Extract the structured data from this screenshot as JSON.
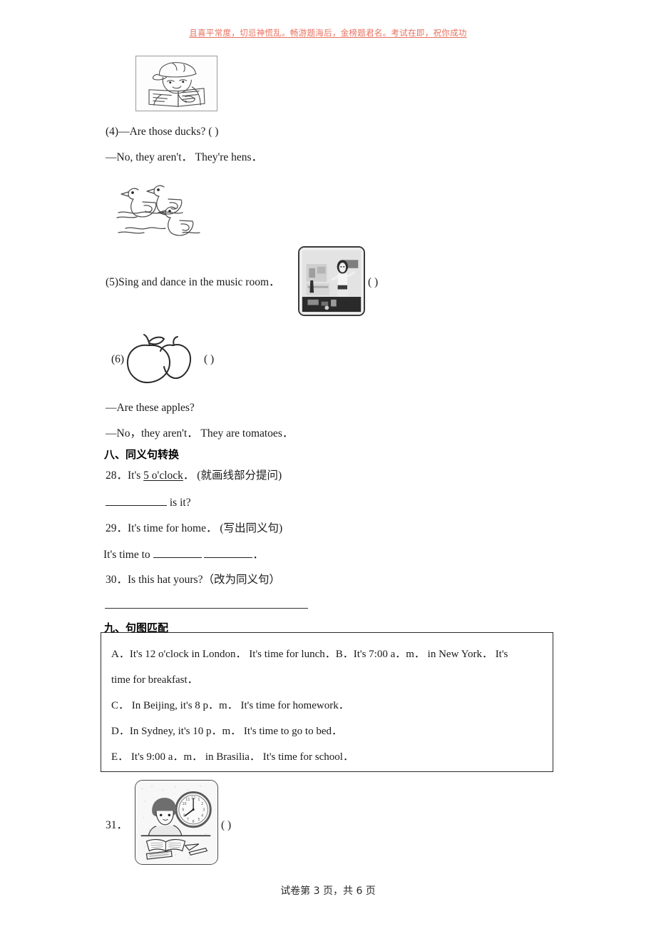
{
  "header": {
    "slogan": "且喜平常度，切忌神慌乱。畅游题海后，金榜题君名。考试在即，祝你成功"
  },
  "questions": {
    "q4_line1": "(4)—Are those ducks?    (      )",
    "q4_line2": "—No, they aren't．  They're hens．",
    "q5_line": "(5)Sing and dance in the music room．",
    "q5_bracket": "(      )",
    "q6_number": "(6)",
    "q6_bracket": "(      )",
    "q6_line1": "—Are these apples?",
    "q6_line2": "—No，they aren't．  They are tomatoes．"
  },
  "section8": {
    "heading": "八、同义句转换",
    "q28_prefix": "28．It's ",
    "q28_underlined": "5 o'clock",
    "q28_suffix": "．  (就画线部分提问)",
    "q28_answer_suffix": " is it?",
    "q29": "29．It's time for home．  (写出同义句)",
    "q29_answer_prefix": "It's time to ",
    "q29_answer_suffix": "．",
    "q30": "30．Is this hat yours?（改为同义句）"
  },
  "section9": {
    "heading": "九、句图匹配",
    "options": [
      "A．It's 12 o'clock in London．   It's time for lunch．B．It's 7:00 a．m．   in New York．   It's",
      "time for breakfast．",
      "C．  In Beijing, it's 8 p．m．  It's time for homework．",
      "D．In Sydney, it's 10 p．m．  It's time to go to bed．",
      "E．  It's 9:00 a．m．  in Brasilia．  It's time for school．"
    ],
    "q31_number": "31．",
    "q31_bracket": "(          )"
  },
  "figures": {
    "boy_reading": "boy-reading-book-illustration",
    "three_ducks": "three-ducks-swimming-illustration",
    "music_room": "music-room-photo",
    "two_apples": "two-apples-illustration",
    "boy_homework_clock": "boy-doing-homework-with-clock-photo"
  },
  "footer": {
    "text": "试卷第 3 页，共 6 页"
  }
}
